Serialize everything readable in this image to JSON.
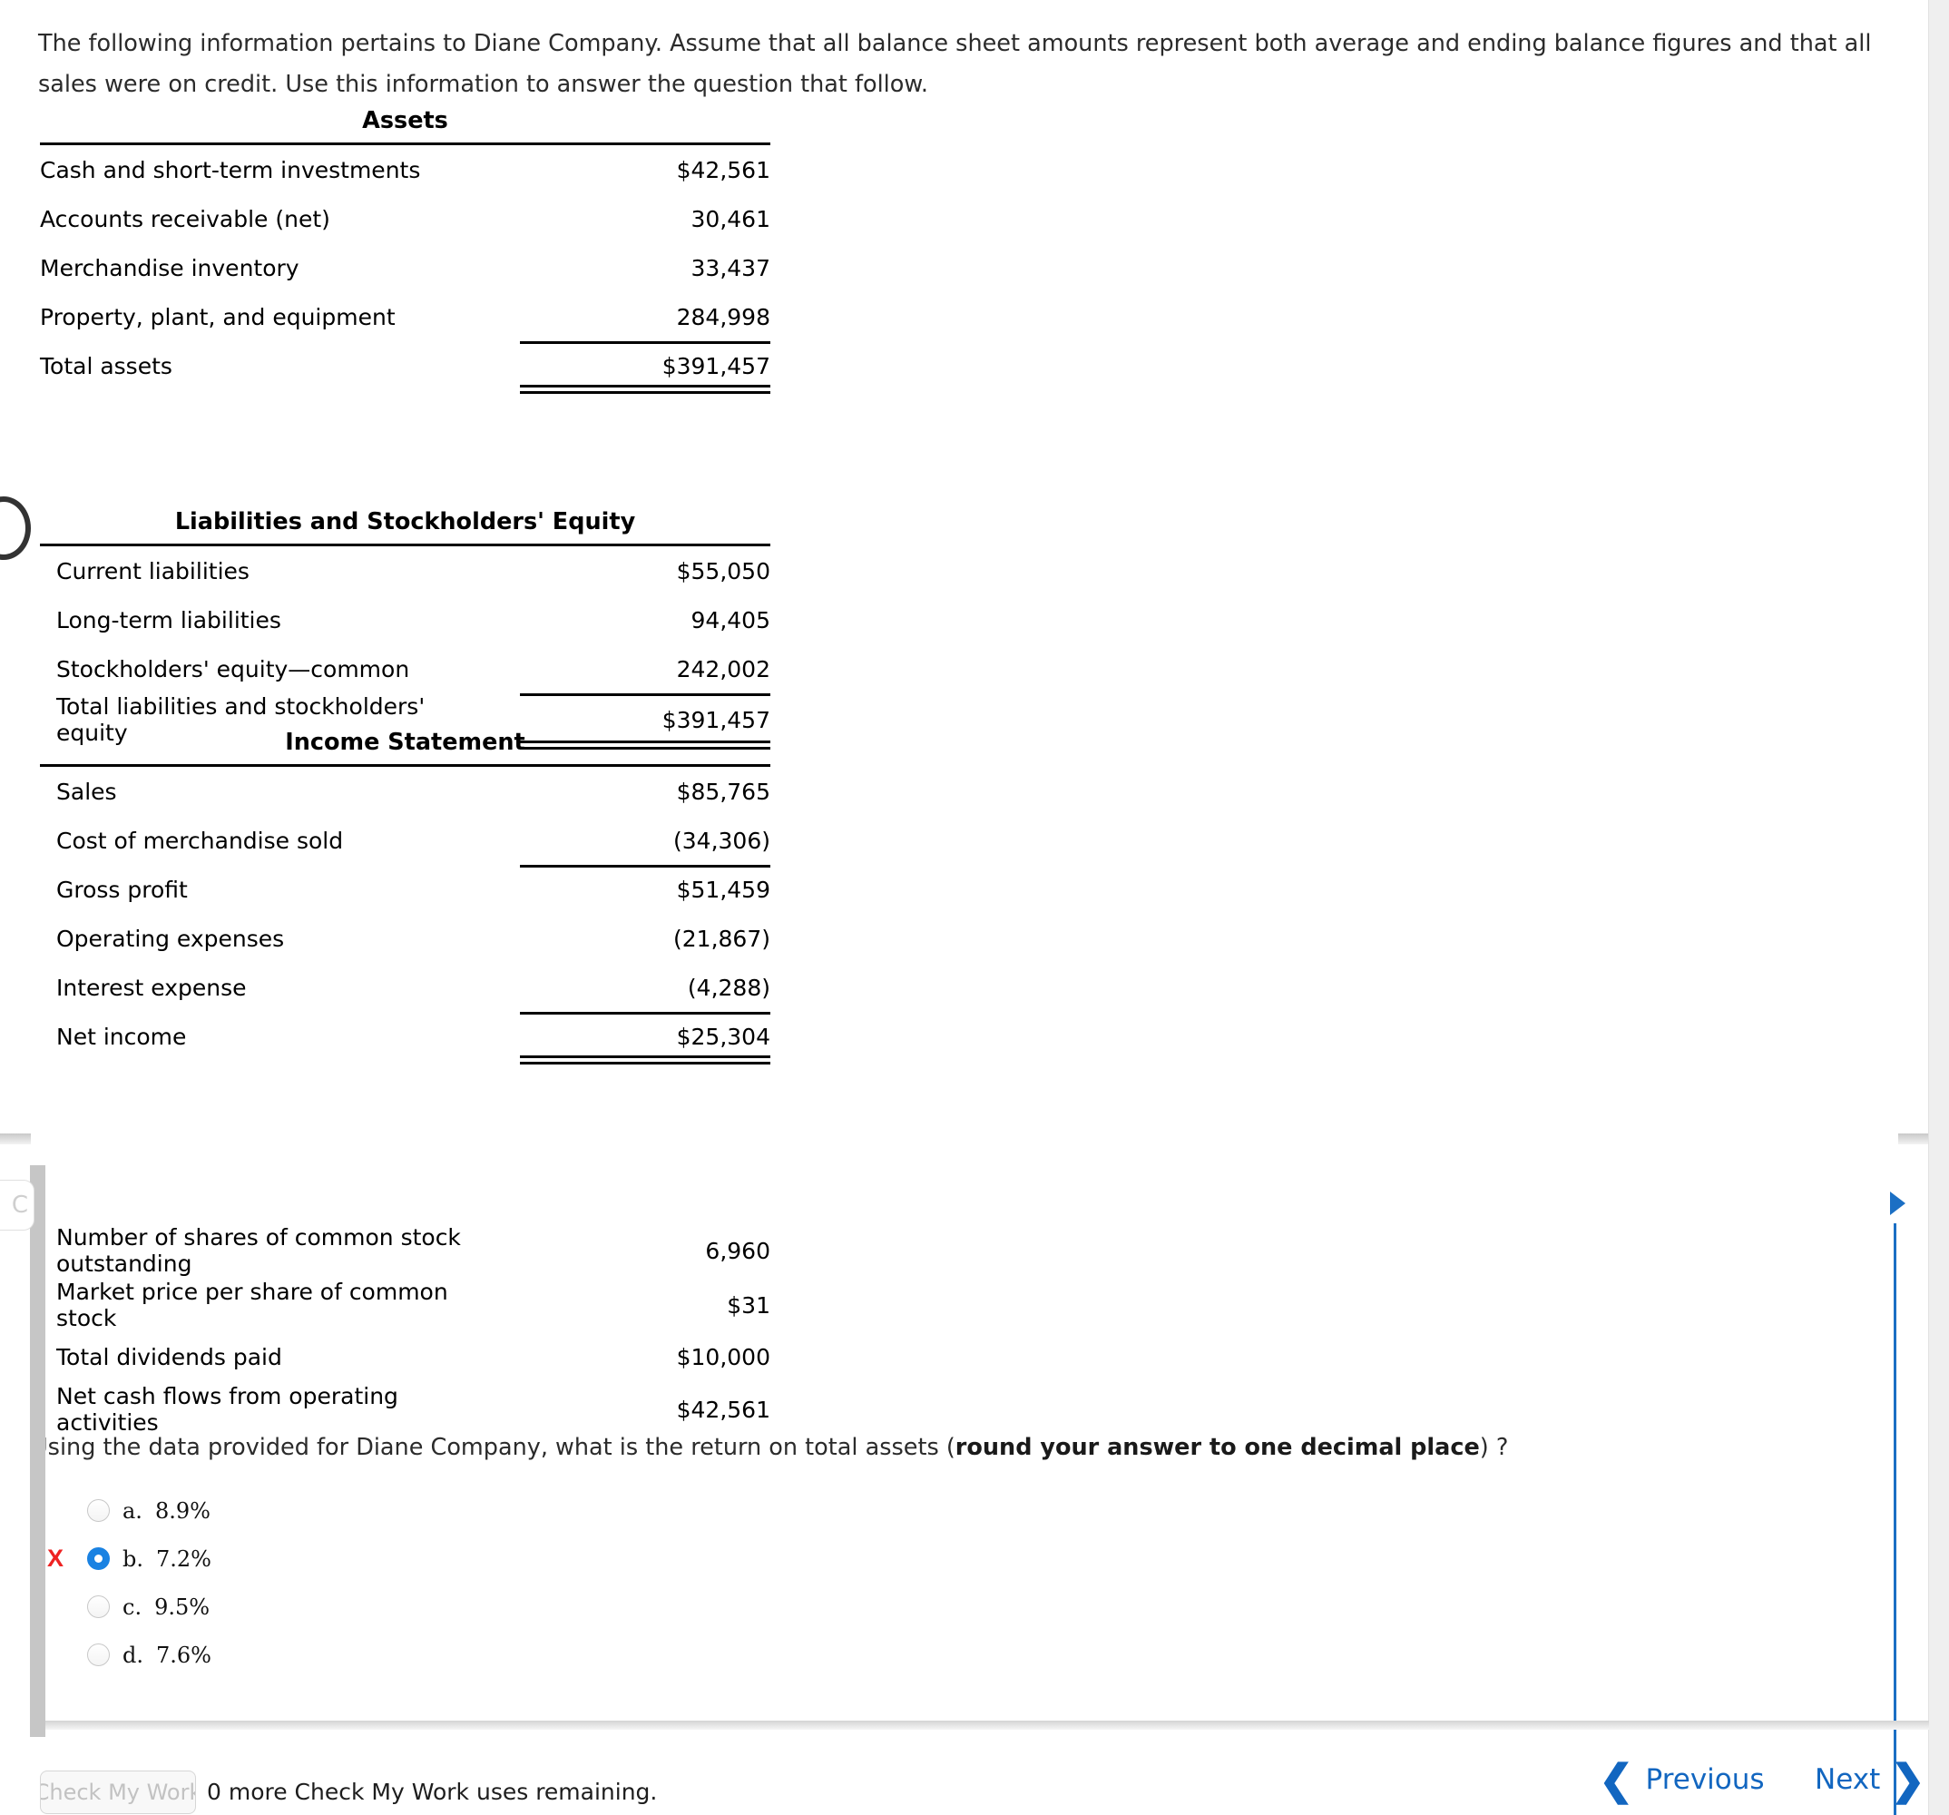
{
  "intro": {
    "text": "The following information pertains to Diane Company. Assume that all balance sheet amounts represent both average and ending balance figures and that all sales were on credit. Use this information to answer the question that follow."
  },
  "statements": [
    {
      "title": "Assets",
      "rows": [
        {
          "label": "Cash and short-term investments",
          "value": "$42,561"
        },
        {
          "label": "Accounts receivable (net)",
          "value": "30,461"
        },
        {
          "label": "Merchandise inventory",
          "value": "33,437"
        },
        {
          "label": "Property, plant, and equipment",
          "value": "284,998"
        },
        {
          "label": "Total assets",
          "value": "$391,457"
        }
      ]
    },
    {
      "title": "Liabilities and Stockholders' Equity",
      "rows": [
        {
          "label": "Current liabilities",
          "value": "$55,050"
        },
        {
          "label": "Long-term liabilities",
          "value": "94,405"
        },
        {
          "label": "Stockholders' equity—common",
          "value": "242,002"
        },
        {
          "label": "Total liabilities and stockholders' equity",
          "value": "$391,457"
        }
      ]
    },
    {
      "title": "Income Statement",
      "rows": [
        {
          "label": "Sales",
          "value": "$85,765"
        },
        {
          "label": "Cost of merchandise sold",
          "value": "(34,306)"
        },
        {
          "label": "Gross profit",
          "value": "$51,459"
        },
        {
          "label": "Operating expenses",
          "value": "(21,867)"
        },
        {
          "label": "Interest expense",
          "value": "(4,288)"
        },
        {
          "label": "Net income",
          "value": "$25,304"
        }
      ]
    }
  ],
  "supplemental": [
    {
      "label": "Number of shares of common stock outstanding",
      "value": "6,960"
    },
    {
      "label": "Market price per share of common stock",
      "value": "$31"
    },
    {
      "label": "Total dividends paid",
      "value": "$10,000"
    },
    {
      "label": "Net cash flows from operating activities",
      "value": "$42,561"
    }
  ],
  "question": {
    "lead": "Using the data provided for Diane Company, what is the return on total assets (",
    "bold": "round your answer to one decimal place",
    "tail": ") ?"
  },
  "choices": [
    {
      "letter": "a.",
      "text": "8.9%",
      "selected": false,
      "marked_wrong": false
    },
    {
      "letter": "b.",
      "text": "7.2%",
      "selected": true,
      "marked_wrong": true
    },
    {
      "letter": "c.",
      "text": "9.5%",
      "selected": false,
      "marked_wrong": false
    },
    {
      "letter": "d.",
      "text": "7.6%",
      "selected": false,
      "marked_wrong": false
    }
  ],
  "wrong_mark": "X",
  "footer": {
    "check_my_work_label": "Check My Work",
    "uses_remaining": "0 more Check My Work uses remaining.",
    "previous_label": "Previous",
    "next_label": "Next",
    "prev_chevron": "❮",
    "next_chevron": "❯",
    "clipped_button_label": "C"
  },
  "colors": {
    "link_blue": "#1266c0",
    "selected_radio_blue": "#1a82e2",
    "wrong_red": "#ee2222",
    "panel_gray": "#c6c6c6"
  }
}
